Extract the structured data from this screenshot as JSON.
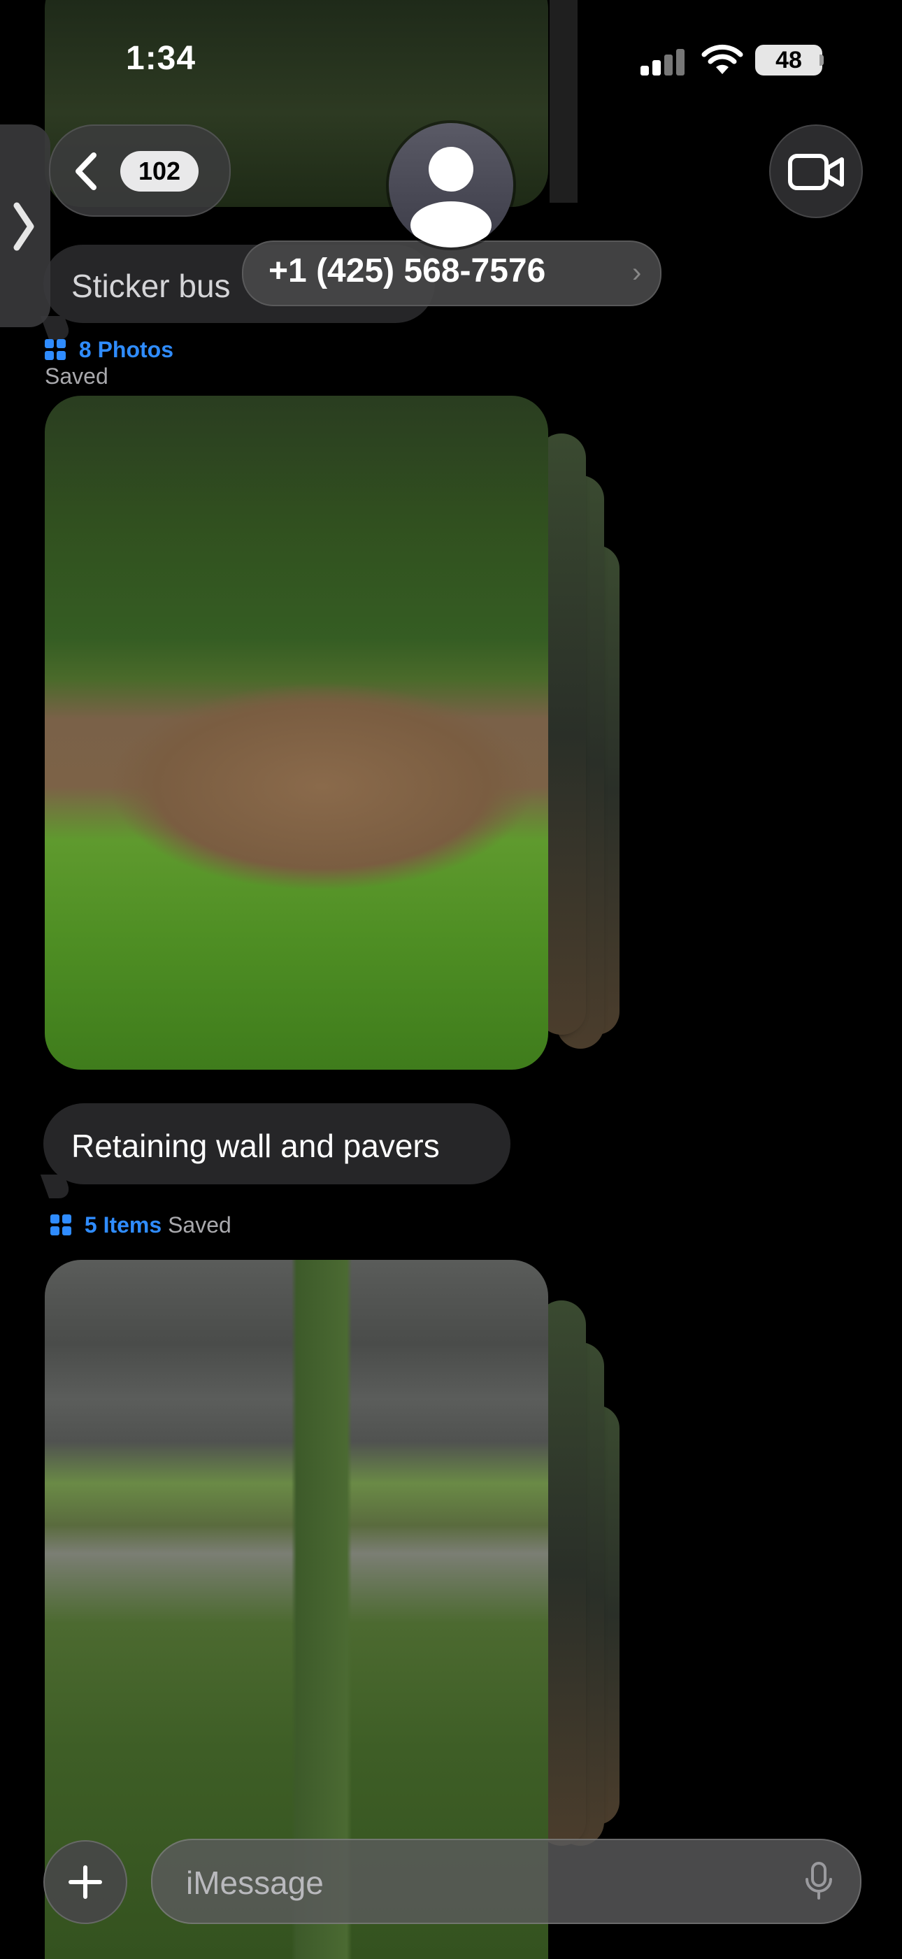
{
  "status_bar": {
    "time": "1:34",
    "battery": "48"
  },
  "nav": {
    "unread_count": "102",
    "contact": "+1 (425) 568-7576"
  },
  "messages": {
    "partial_bubble": "Sticker bus",
    "first_saved": {
      "link": "8 Photos",
      "status": "Saved"
    },
    "retaining_bubble": "Retaining wall and pavers",
    "second_saved": {
      "link": "5 Items",
      "status": "Saved"
    }
  },
  "compose": {
    "placeholder": "iMessage"
  },
  "icons": {
    "back": "chevron-left-icon",
    "avatar": "person-icon",
    "video": "video-camera-icon",
    "side": "chevron-right-icon",
    "grid": "photo-grid-icon",
    "plus": "plus-icon",
    "mic": "microphone-icon"
  },
  "colors": {
    "accent": "#2f8cff",
    "bubble": "#262628",
    "background": "#000000"
  }
}
